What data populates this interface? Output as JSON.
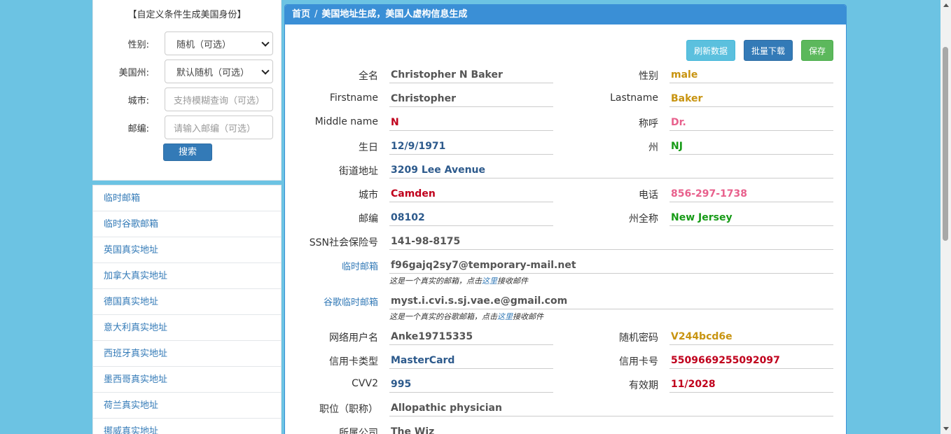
{
  "search": {
    "title": "【自定义条件生成美国身份】",
    "gender_label": "性别:",
    "gender_value": "随机（可选）",
    "state_label": "美国州:",
    "state_value": "默认随机（可选）",
    "city_label": "城市:",
    "city_placeholder": "支持模糊查询（可选）",
    "zip_label": "邮编:",
    "zip_placeholder": "请输入邮编（可选）",
    "button": "搜索"
  },
  "nav": [
    "临时邮箱",
    "临时谷歌邮箱",
    "英国真实地址",
    "加拿大真实地址",
    "德国真实地址",
    "意大利真实地址",
    "西班牙真实地址",
    "墨西哥真实地址",
    "荷兰真实地址",
    "挪威真实地址"
  ],
  "header": {
    "home": "首页",
    "sep": "/",
    "title": "美国地址生成，美国人虚构信息生成"
  },
  "actions": {
    "refresh": "刷新数据",
    "download": "批量下载",
    "save": "保存"
  },
  "fields": {
    "fullname": {
      "label": "全名",
      "value": "Christopher N Baker"
    },
    "gender": {
      "label": "性别",
      "value": "male"
    },
    "firstname": {
      "label": "Firstname",
      "value": "Christopher"
    },
    "lastname": {
      "label": "Lastname",
      "value": "Baker"
    },
    "middlename": {
      "label": "Middle name",
      "value": "N"
    },
    "title": {
      "label": "称呼",
      "value": "Dr."
    },
    "birthday": {
      "label": "生日",
      "value": "12/9/1971"
    },
    "state": {
      "label": "州",
      "value": "NJ"
    },
    "street": {
      "label": "街道地址",
      "value": "3209 Lee Avenue"
    },
    "city": {
      "label": "城市",
      "value": "Camden"
    },
    "phone": {
      "label": "电话",
      "value": "856-297-1738"
    },
    "zip": {
      "label": "邮编",
      "value": "08102"
    },
    "state_full": {
      "label": "州全称",
      "value": "New Jersey"
    },
    "ssn": {
      "label": "SSN社会保险号",
      "value": "141-98-8175"
    },
    "temp_email": {
      "label": "临时邮箱",
      "value": "f96gajq2sy7@temporary-mail.net",
      "note_pre": "这是一个真实的邮箱，点击",
      "note_link": "这里",
      "note_post": "接收邮件"
    },
    "gmail": {
      "label": "谷歌临时邮箱",
      "value": "myst.i.cvi.s.sj.vae.e@gmail.com",
      "note_pre": "这是一个真实的谷歌邮箱，点击",
      "note_link": "这里",
      "note_post": "接收邮件"
    },
    "username": {
      "label": "网络用户名",
      "value": "Anke19715335"
    },
    "password": {
      "label": "随机密码",
      "value": "V244bcd6e"
    },
    "card_type": {
      "label": "信用卡类型",
      "value": "MasterCard"
    },
    "card_number": {
      "label": "信用卡号",
      "value": "5509669255092097"
    },
    "cvv": {
      "label": "CVV2",
      "value": "995"
    },
    "expiry": {
      "label": "有效期",
      "value": "11/2028"
    },
    "occupation": {
      "label": "职位（职称）",
      "value": "Allopathic physician"
    },
    "company": {
      "label": "所属公司",
      "value": "The Wiz"
    }
  },
  "colors": {
    "gray": "#555555",
    "blue": "#2d5a8c",
    "red": "#c0001c",
    "green": "#179b17",
    "gold": "#c89411",
    "pink": "#e8608c"
  }
}
